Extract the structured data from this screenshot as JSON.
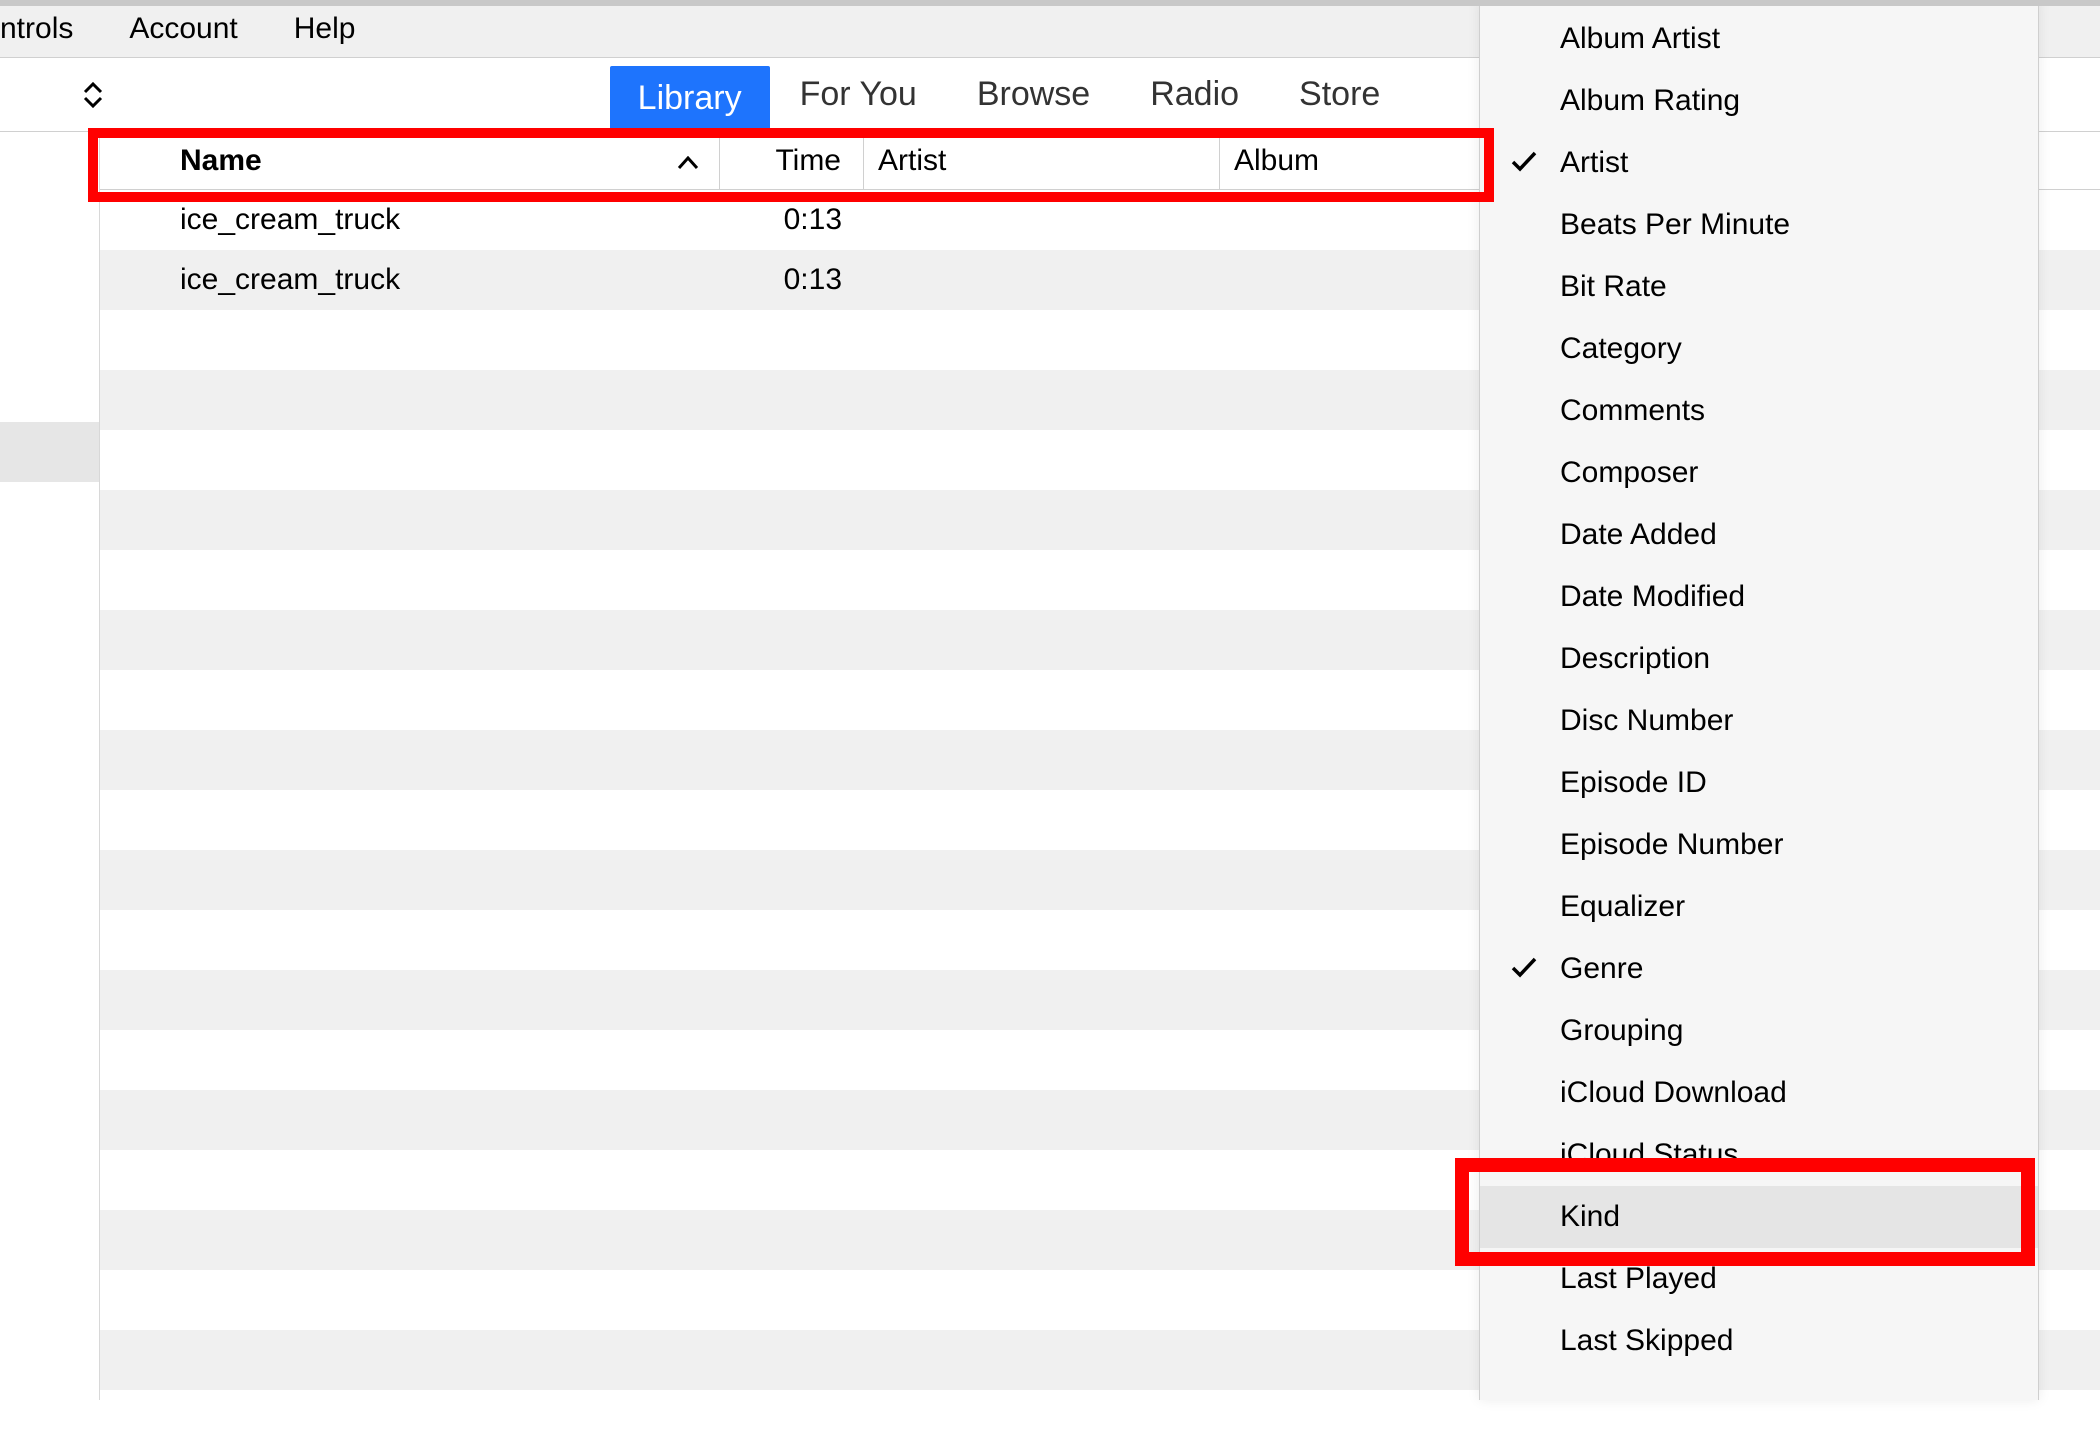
{
  "menubar": {
    "items": [
      "ntrols",
      "Account",
      "Help"
    ]
  },
  "tabs": {
    "items": [
      "Library",
      "For You",
      "Browse",
      "Radio",
      "Store"
    ],
    "active_index": 0
  },
  "columns": {
    "name": "Name",
    "time": "Time",
    "artist": "Artist",
    "album": "Album",
    "sorted_column": "name",
    "sort_direction": "asc"
  },
  "tracks": [
    {
      "name": "ice_cream_truck",
      "time": "0:13",
      "artist": "",
      "album": ""
    },
    {
      "name": "ice_cream_truck",
      "time": "0:13",
      "artist": "",
      "album": ""
    }
  ],
  "context_menu": {
    "items": [
      {
        "label": "Album Artist",
        "checked": false
      },
      {
        "label": "Album Rating",
        "checked": false
      },
      {
        "label": "Artist",
        "checked": true
      },
      {
        "label": "Beats Per Minute",
        "checked": false
      },
      {
        "label": "Bit Rate",
        "checked": false
      },
      {
        "label": "Category",
        "checked": false
      },
      {
        "label": "Comments",
        "checked": false
      },
      {
        "label": "Composer",
        "checked": false
      },
      {
        "label": "Date Added",
        "checked": false
      },
      {
        "label": "Date Modified",
        "checked": false
      },
      {
        "label": "Description",
        "checked": false
      },
      {
        "label": "Disc Number",
        "checked": false
      },
      {
        "label": "Episode ID",
        "checked": false
      },
      {
        "label": "Episode Number",
        "checked": false
      },
      {
        "label": "Equalizer",
        "checked": false
      },
      {
        "label": "Genre",
        "checked": true
      },
      {
        "label": "Grouping",
        "checked": false
      },
      {
        "label": "iCloud Download",
        "checked": false
      },
      {
        "label": "iCloud Status",
        "checked": false
      },
      {
        "label": "Kind",
        "checked": false,
        "hovered": true
      },
      {
        "label": "Last Played",
        "checked": false
      },
      {
        "label": "Last Skipped",
        "checked": false
      }
    ]
  },
  "annotations": {
    "header_highlighted": true,
    "kind_highlighted": true
  }
}
